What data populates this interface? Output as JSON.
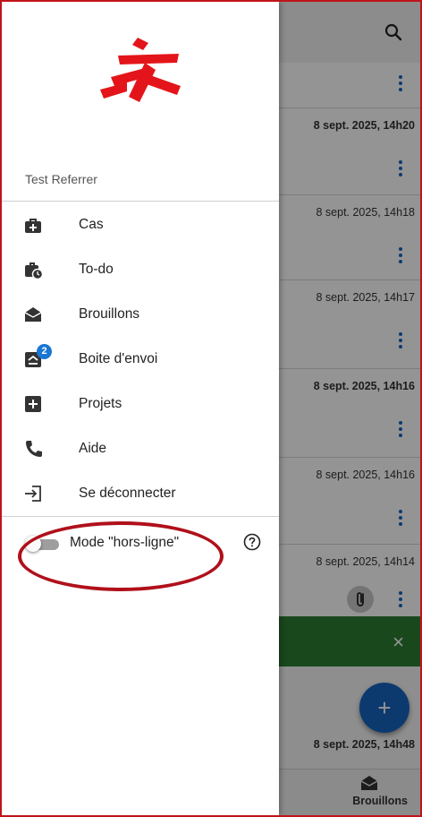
{
  "background_app": {
    "list_items": [
      {
        "date": "",
        "bold": false,
        "has_attachment": false
      },
      {
        "date": "8 sept. 2025, 14h20",
        "bold": true,
        "has_attachment": false
      },
      {
        "date": "8 sept. 2025, 14h18",
        "bold": false,
        "has_attachment": false
      },
      {
        "date": "8 sept. 2025, 14h17",
        "bold": false,
        "has_attachment": false
      },
      {
        "date": "8 sept. 2025, 14h16",
        "bold": true,
        "has_attachment": false
      },
      {
        "date": "8 sept. 2025, 14h16",
        "bold": false,
        "has_attachment": false
      },
      {
        "date": "8 sept. 2025, 14h14",
        "bold": false,
        "has_attachment": true
      }
    ],
    "snackbar_close": "×",
    "fab_label": "+",
    "partial_date": "8 sept. 2025, 14h48",
    "bottom_nav_label": "Brouillons",
    "colors": {
      "fab": "#1565c0",
      "snackbar": "#2e7d32"
    }
  },
  "drawer": {
    "user_name": "Test Referrer",
    "menu": [
      {
        "label": "Cas",
        "icon": "medical-bag-icon"
      },
      {
        "label": "To-do",
        "icon": "briefcase-clock-icon"
      },
      {
        "label": "Brouillons",
        "icon": "open-envelope-icon"
      },
      {
        "label": "Boite d'envoi",
        "icon": "outbox-icon",
        "badge": "2"
      },
      {
        "label": "Projets",
        "icon": "plus-box-icon"
      },
      {
        "label": "Aide",
        "icon": "phone-icon"
      },
      {
        "label": "Se déconnecter",
        "icon": "logout-icon"
      }
    ],
    "offline_mode": {
      "label": "Mode \"hors-ligne\"",
      "enabled": false
    }
  },
  "annotation": {
    "color": "#b0101b",
    "target": "offline-mode"
  }
}
